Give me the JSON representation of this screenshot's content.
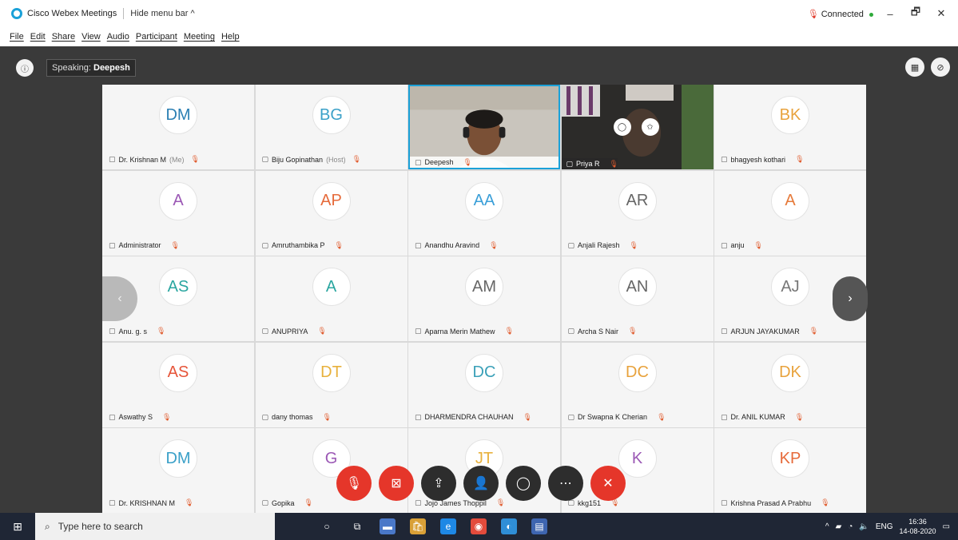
{
  "titlebar": {
    "app_title": "Cisco Webex Meetings",
    "hide_menu": "Hide menu bar ^",
    "status": "Connected",
    "minimize": "–",
    "restore": "🗗",
    "close": "✕"
  },
  "menu": [
    "File",
    "Edit",
    "Share",
    "View",
    "Audio",
    "Participant",
    "Meeting",
    "Help"
  ],
  "meeting": {
    "speaking_label": "Speaking:",
    "speaking_name": "Deepesh"
  },
  "participants": [
    {
      "initials": "DM",
      "name": "Dr. Krishnan M",
      "role": "(Me)",
      "color": "#2b7fb3"
    },
    {
      "initials": "BG",
      "name": "Biju Gopinathan",
      "role": "(Host)",
      "color": "#3aa0c8"
    },
    {
      "initials": "",
      "name": "Deepesh",
      "role": "",
      "color": "",
      "video": true
    },
    {
      "initials": "",
      "name": "Priya R",
      "role": "",
      "color": "",
      "video": true
    },
    {
      "initials": "BK",
      "name": "bhagyesh kothari",
      "role": "",
      "color": "#e8a23c"
    },
    {
      "initials": "A",
      "name": "Administrator",
      "role": "",
      "color": "#9b58b5"
    },
    {
      "initials": "AP",
      "name": "Amruthambika P",
      "role": "",
      "color": "#e66a3a"
    },
    {
      "initials": "AA",
      "name": "Anandhu Aravind",
      "role": "",
      "color": "#3a9fd8"
    },
    {
      "initials": "AR",
      "name": "Anjali Rajesh",
      "role": "",
      "color": "#666666"
    },
    {
      "initials": "A",
      "name": "anju",
      "role": "",
      "color": "#e67a3a"
    },
    {
      "initials": "AS",
      "name": "Anu. g. s",
      "role": "",
      "color": "#2aa6a0"
    },
    {
      "initials": "A",
      "name": "ANUPRIYA",
      "role": "",
      "color": "#2aa6a0"
    },
    {
      "initials": "AM",
      "name": "Aparna Merin Mathew",
      "role": "",
      "color": "#666666"
    },
    {
      "initials": "AN",
      "name": "Archa S Nair",
      "role": "",
      "color": "#666666"
    },
    {
      "initials": "AJ",
      "name": "ARJUN JAYAKUMAR",
      "role": "",
      "color": "#777777"
    },
    {
      "initials": "AS",
      "name": "Aswathy S",
      "role": "",
      "color": "#e6553a"
    },
    {
      "initials": "DT",
      "name": "dany thomas",
      "role": "",
      "color": "#e8b13c"
    },
    {
      "initials": "DC",
      "name": "DHARMENDRA CHAUHAN",
      "role": "",
      "color": "#3aa0b8"
    },
    {
      "initials": "DC",
      "name": "Dr Swapna K Cherian",
      "role": "",
      "color": "#e8a23c"
    },
    {
      "initials": "DK",
      "name": "Dr. ANIL KUMAR",
      "role": "",
      "color": "#e8a23c"
    },
    {
      "initials": "DM",
      "name": "Dr. KRISHNAN M",
      "role": "",
      "color": "#3aa0c8"
    },
    {
      "initials": "G",
      "name": "Gopika",
      "role": "",
      "color": "#9b58b5"
    },
    {
      "initials": "JT",
      "name": "Jojo James Thoppil",
      "role": "",
      "color": "#e8b13c"
    },
    {
      "initials": "K",
      "name": "kkg151",
      "role": "",
      "color": "#9b58b5"
    },
    {
      "initials": "KP",
      "name": "Krishna Prasad A Prabhu",
      "role": "",
      "color": "#e66a3a"
    }
  ],
  "taskbar": {
    "search_placeholder": "Type here to search",
    "language": "ENG",
    "time": "16:36",
    "date": "14-08-2020"
  }
}
